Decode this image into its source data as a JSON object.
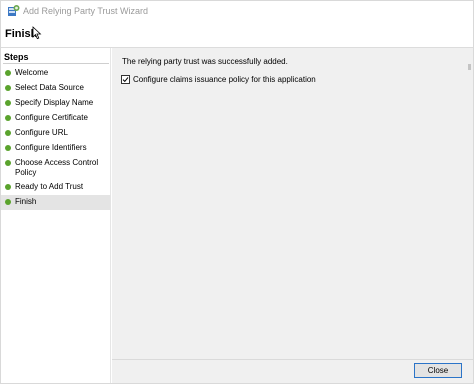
{
  "window": {
    "title": "Add Relying Party Trust Wizard",
    "icon": "adfs-server-icon"
  },
  "header": {
    "page_title": "Finish"
  },
  "sidebar": {
    "heading": "Steps",
    "steps": [
      {
        "label": "Welcome",
        "status": "complete"
      },
      {
        "label": "Select Data Source",
        "status": "complete"
      },
      {
        "label": "Specify Display Name",
        "status": "complete"
      },
      {
        "label": "Configure Certificate",
        "status": "complete"
      },
      {
        "label": "Configure URL",
        "status": "complete"
      },
      {
        "label": "Configure Identifiers",
        "status": "complete"
      },
      {
        "label": "Choose Access Control Policy",
        "status": "complete"
      },
      {
        "label": "Ready to Add Trust",
        "status": "complete"
      },
      {
        "label": "Finish",
        "status": "current"
      }
    ]
  },
  "main": {
    "message": "The relying party trust was successfully added.",
    "checkbox": {
      "label": "Configure claims issuance policy for this application",
      "checked": true
    }
  },
  "footer": {
    "close_label": "Close"
  },
  "colors": {
    "step_dot": "#5aa32c",
    "focus_border": "#2b74c8",
    "content_bg": "#f0f0f0"
  }
}
